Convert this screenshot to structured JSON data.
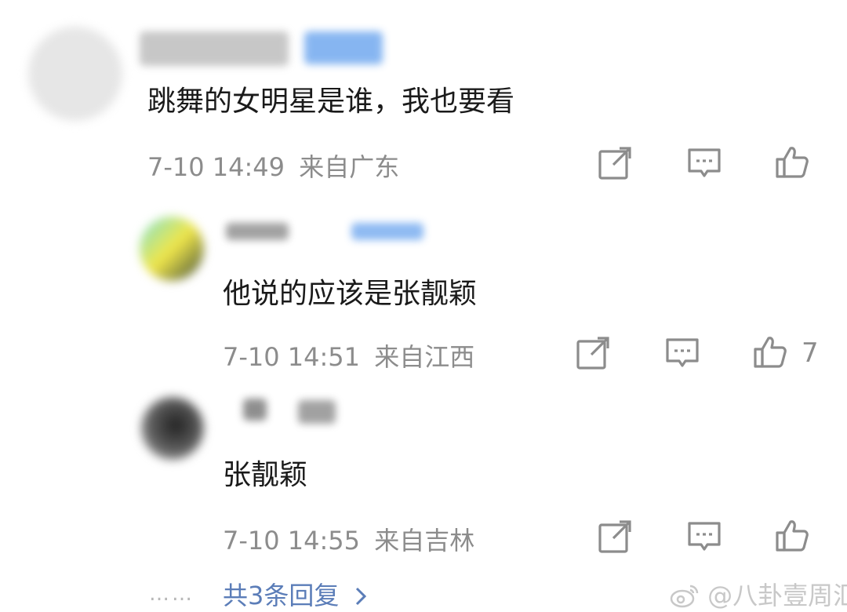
{
  "comments": [
    {
      "text": "跳舞的女明星是谁，我也要看",
      "time": "7-10 14:49",
      "location": "来自广东",
      "likes": ""
    },
    {
      "text": "他说的应该是张靓颖",
      "time": "7-10 14:51",
      "location": "来自江西",
      "likes": "7"
    },
    {
      "text": "张靓颖",
      "time": "7-10 14:55",
      "location": "来自吉林",
      "likes": ""
    }
  ],
  "more_replies": "共3条回复",
  "dots": "……",
  "watermark": "@八卦壹周汇",
  "colors": {
    "meta": "#8c8c8c",
    "link": "#5b7db8",
    "verified": "#7aaef0"
  }
}
